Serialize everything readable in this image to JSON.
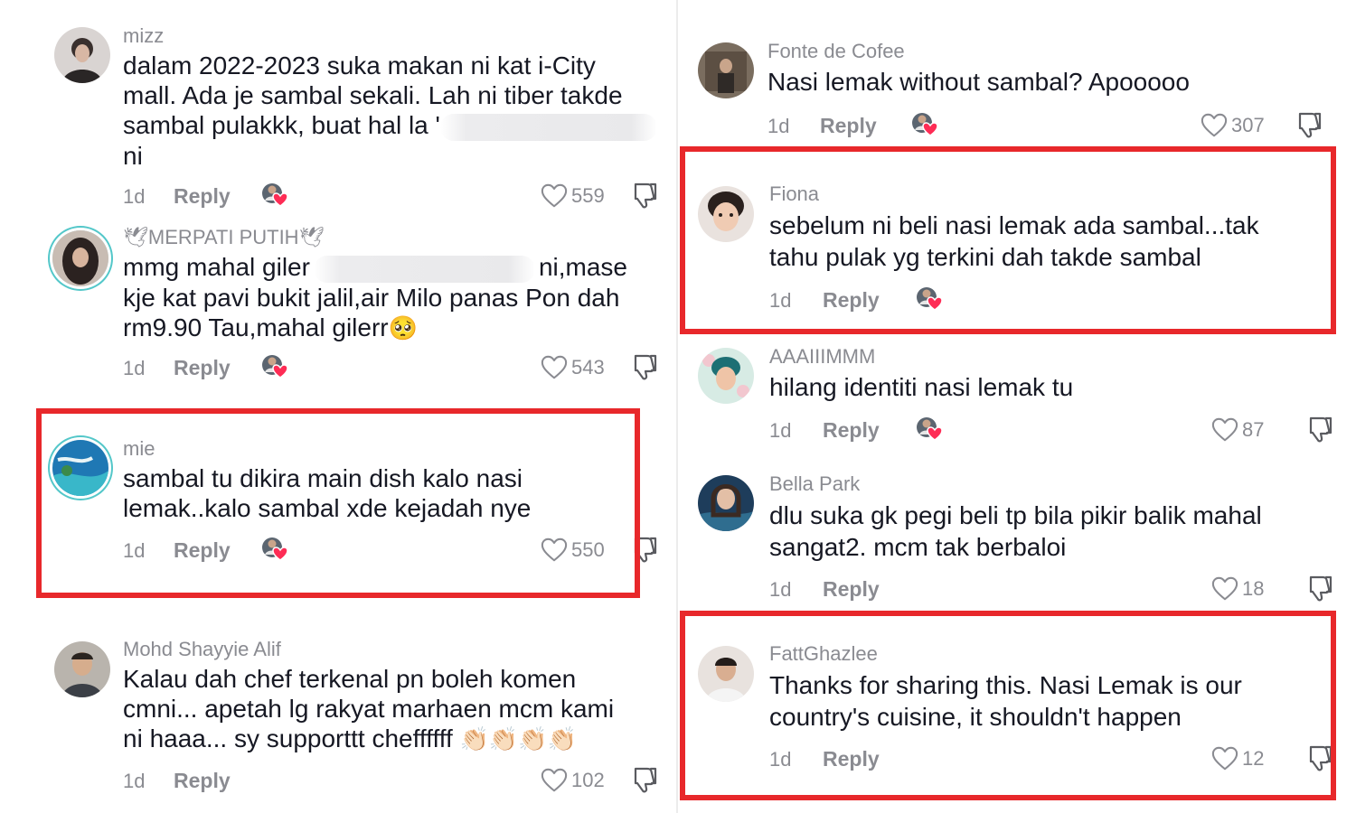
{
  "colors": {
    "highlight": "#e8282b",
    "muted": "#8a8b91",
    "text": "#161823",
    "avatar_ring": "#53c7c9"
  },
  "left": [
    {
      "user": "mizz",
      "line1": "dalam 2022-2023 suka makan ni kat i-City",
      "line2": "mall. Ada je sambal sekali. Lah ni tiber takde",
      "line3": "sambal pulakkk, buat hal la '",
      "line4": "ni",
      "time": "1d",
      "reply": "Reply",
      "likes": "559"
    },
    {
      "user": "🕊MERPATI PUTIH🕊",
      "line1a": "mmg mahal giler",
      "line1b": "ni,mase",
      "line2": "kje kat pavi bukit jalil,air Milo panas Pon dah",
      "line3": "rm9.90 Tau,mahal gilerr",
      "emoji": "🥺",
      "time": "1d",
      "reply": "Reply",
      "likes": "543"
    },
    {
      "user": "mie",
      "line1": "sambal tu dikira main dish kalo nasi",
      "line2": "lemak..kalo sambal xde kejadah nye",
      "time": "1d",
      "reply": "Reply",
      "likes": "550"
    },
    {
      "user": "Mohd  Shayyie  Alif",
      "line1": "Kalau dah chef terkenal pn boleh komen",
      "line2": "cmni... apetah lg rakyat marhaen mcm kami",
      "line3": "ni haaa... sy supporttt cheffffff",
      "emoji": "👏🏻👏🏻👏🏻👏🏻",
      "time": "1d",
      "reply": "Reply",
      "likes": "102"
    }
  ],
  "right": [
    {
      "user": "Fonte de Cofee",
      "line1": "Nasi lemak without sambal? Apooooo",
      "time": "1d",
      "reply": "Reply",
      "likes": "307"
    },
    {
      "user": "Fiona",
      "line1": "sebelum ni beli nasi lemak ada sambal...tak",
      "line2": "tahu pulak yg terkini dah takde sambal",
      "time": "1d",
      "reply": "Reply"
    },
    {
      "user": "AAAIIIMMM",
      "line1": "hilang identiti nasi lemak tu",
      "time": "1d",
      "reply": "Reply",
      "likes": "87"
    },
    {
      "user": "Bella Park",
      "line1": "dlu suka gk pegi beli tp bila pikir balik mahal",
      "line2": "sangat2. mcm tak berbaloi",
      "time": "1d",
      "reply": "Reply",
      "likes": "18"
    },
    {
      "user": "FattGhazlee",
      "line1": "Thanks for sharing this. Nasi Lemak is our",
      "line2": "country's cuisine, it shouldn't happen",
      "time": "1d",
      "reply": "Reply",
      "likes": "12"
    }
  ]
}
